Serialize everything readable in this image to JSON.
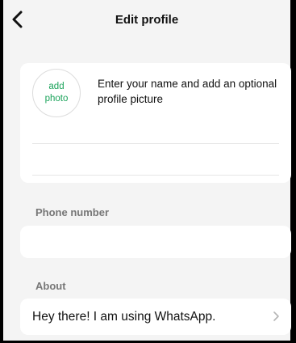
{
  "header": {
    "title": "Edit profile"
  },
  "profile": {
    "photo_line1": "add",
    "photo_line2": "photo",
    "hint": "Enter your name and add an optional profile picture",
    "name_value": ""
  },
  "phone": {
    "label": "Phone number",
    "value": ""
  },
  "about": {
    "label": "About",
    "value": "Hey there! I am using WhatsApp."
  },
  "colors": {
    "accent": "#1aa35a",
    "background": "#f4f4f4",
    "card": "#ffffff"
  },
  "icons": {
    "back": "chevron-left-icon",
    "about_chevron": "chevron-right-icon"
  }
}
